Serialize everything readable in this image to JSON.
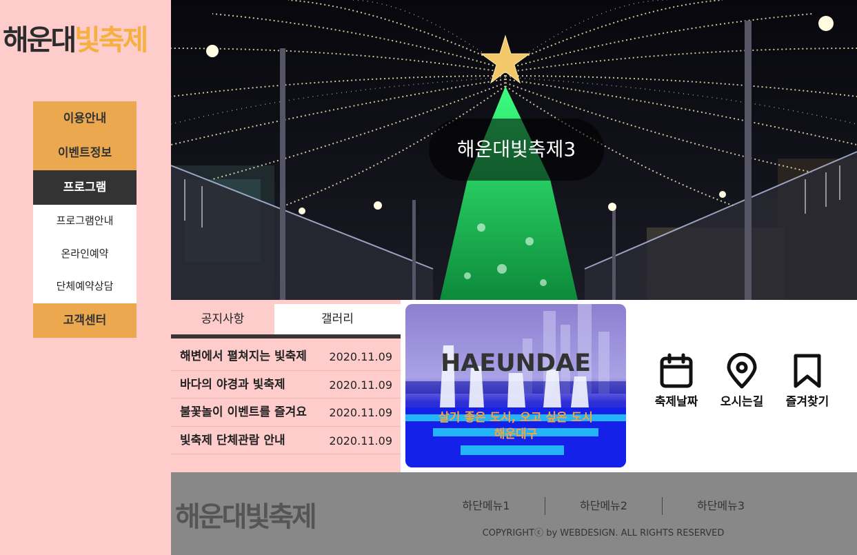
{
  "logo": {
    "part1": "해운대",
    "part2": "빛축제"
  },
  "menu": {
    "items": [
      "이용안내",
      "이벤트정보",
      "프로그램",
      "고객센터"
    ],
    "sub": [
      "프로그램안내",
      "온라인예약",
      "단체예약상담"
    ]
  },
  "hero": {
    "caption": "해운대빛축제3"
  },
  "board": {
    "tabs": [
      "공지사항",
      "갤러리"
    ],
    "rows": [
      {
        "title": "해변에서 펼쳐지는 빛축제",
        "date": "2020.11.09"
      },
      {
        "title": "바다의 야경과 빛축제",
        "date": "2020.11.09"
      },
      {
        "title": "불꽃놀이 이벤트를 즐겨요",
        "date": "2020.11.09"
      },
      {
        "title": "빛축제 단체관람 안내",
        "date": "2020.11.09"
      }
    ]
  },
  "banner": {
    "title": "HAEUNDAE",
    "line1": "살기 좋은 도시, 오고 싶은 도시",
    "line2": "해운대구"
  },
  "quick": {
    "items": [
      {
        "label": "축제날짜",
        "icon": "calendar-icon"
      },
      {
        "label": "오시는길",
        "icon": "location-pin-icon"
      },
      {
        "label": "즐겨찾기",
        "icon": "bookmark-icon"
      }
    ]
  },
  "footer": {
    "logo": "해운대빛축제",
    "menu": [
      "하단메뉴1",
      "하단메뉴2",
      "하단메뉴3"
    ],
    "copyright": "COPYRIGHTⓒ by WEBDESIGN. ALL RIGHTS RESERVED"
  },
  "colors": {
    "sidebar_bg": "#ffcccc",
    "accent": "#eba84f",
    "active": "#333333",
    "footer_bg": "#888888",
    "logo_accent": "#f5b041"
  }
}
